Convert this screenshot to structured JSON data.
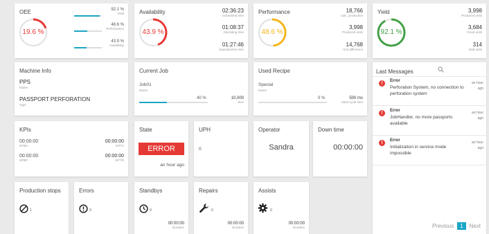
{
  "colors": {
    "accent": "#1ba5c5",
    "red": "#e53935",
    "yellow": "#f4b41a",
    "green": "#43a047",
    "gaugeTrack": "#e0e0e0"
  },
  "oee": {
    "title": "OEE",
    "gauge_value": "19.6 %",
    "gauge_fraction": 0.196,
    "rows": [
      {
        "value": "92.1 %",
        "label": "Yield",
        "fraction": 0.921
      },
      {
        "value": "48.6 %",
        "label": "Performance",
        "fraction": 0.486
      },
      {
        "value": "43.9 %",
        "label": "Availability",
        "fraction": 0.439
      }
    ]
  },
  "availability": {
    "title": "Availability",
    "gauge_value": "43.9 %",
    "gauge_fraction": 0.439,
    "stats": [
      {
        "value": "02:36:23",
        "label": "Scheduled time"
      },
      {
        "value": "01:08:37",
        "label": "Operating time"
      },
      {
        "value": "01:27:46",
        "label": "Unproductive time"
      }
    ]
  },
  "performance": {
    "title": "Performance",
    "gauge_value": "48.6 %",
    "gauge_fraction": 0.486,
    "stats": [
      {
        "value": "18,766",
        "label": "Calc. production"
      },
      {
        "value": "3,998",
        "label": "Produced units"
      },
      {
        "value": "14,768",
        "label": "Unit difference"
      }
    ]
  },
  "yield": {
    "title": "Yield",
    "gauge_value": "92.1 %",
    "gauge_fraction": 0.921,
    "stats": [
      {
        "value": "3,998",
        "label": "Produced units"
      },
      {
        "value": "3,684",
        "label": "Good units"
      },
      {
        "value": "314",
        "label": "Bad units"
      }
    ]
  },
  "machine": {
    "title": "Machine Info",
    "name": "PPS",
    "name_label": "Name",
    "type": "PASSPORT PERFORATION",
    "type_label": "Type"
  },
  "job": {
    "title": "Current Job",
    "name": "Job01",
    "name_label": "Name",
    "progress": "40 %",
    "progress_fraction": 0.4,
    "size": "10,000",
    "size_label": "Size"
  },
  "recipe": {
    "title": "Used Recipe",
    "name": "Special",
    "name_label": "Name",
    "progress": "0 %",
    "progress_fraction": 0.0,
    "cycle": "500 ms",
    "cycle_label": "Ideal cycle time"
  },
  "messages": {
    "title": "Last Messages",
    "items": [
      {
        "type": "Error",
        "text": "Perforation System, no connection to perforation system",
        "time": "an hour ago"
      },
      {
        "type": "Error",
        "text": "JobHandler, no more passports available",
        "time": "an hour ago"
      },
      {
        "type": "Error",
        "text": "Initialization in service mode impossible",
        "time": "an hour ago"
      }
    ],
    "pager": {
      "prev": "Previous",
      "page": "1",
      "next": "Next"
    }
  },
  "kpis": {
    "title": "KPIs",
    "items": [
      {
        "value": "00:00:00",
        "label": "MTBA"
      },
      {
        "value": "00:00:00",
        "label": "MTTA"
      },
      {
        "value": "00:00:00",
        "label": "MTBF"
      },
      {
        "value": "00:00:00",
        "label": "MTTR"
      }
    ]
  },
  "state": {
    "title": "State",
    "value": "ERROR",
    "time": "an hour ago"
  },
  "uph": {
    "title": "UPH",
    "value": "0"
  },
  "operator": {
    "title": "Operator",
    "value": "Sandra"
  },
  "downtime": {
    "title": "Down time",
    "value": "00:00:00"
  },
  "stops": {
    "title": "Production stops",
    "count": "1",
    "icon": "no-entry-icon"
  },
  "errors": {
    "title": "Errors",
    "count": "3",
    "icon": "exclamation-circle-icon"
  },
  "standbys": {
    "title": "Standbys",
    "count": "0",
    "duration": "00:00:00",
    "duration_label": "Duration",
    "icon": "clock-icon"
  },
  "repairs": {
    "title": "Repairs",
    "count": "0",
    "duration": "00:00:00",
    "duration_label": "Duration",
    "icon": "wrench-icon"
  },
  "assists": {
    "title": "Assists",
    "count": "0",
    "duration": "00:00:00",
    "duration_label": "Duration",
    "icon": "gear-icon"
  }
}
